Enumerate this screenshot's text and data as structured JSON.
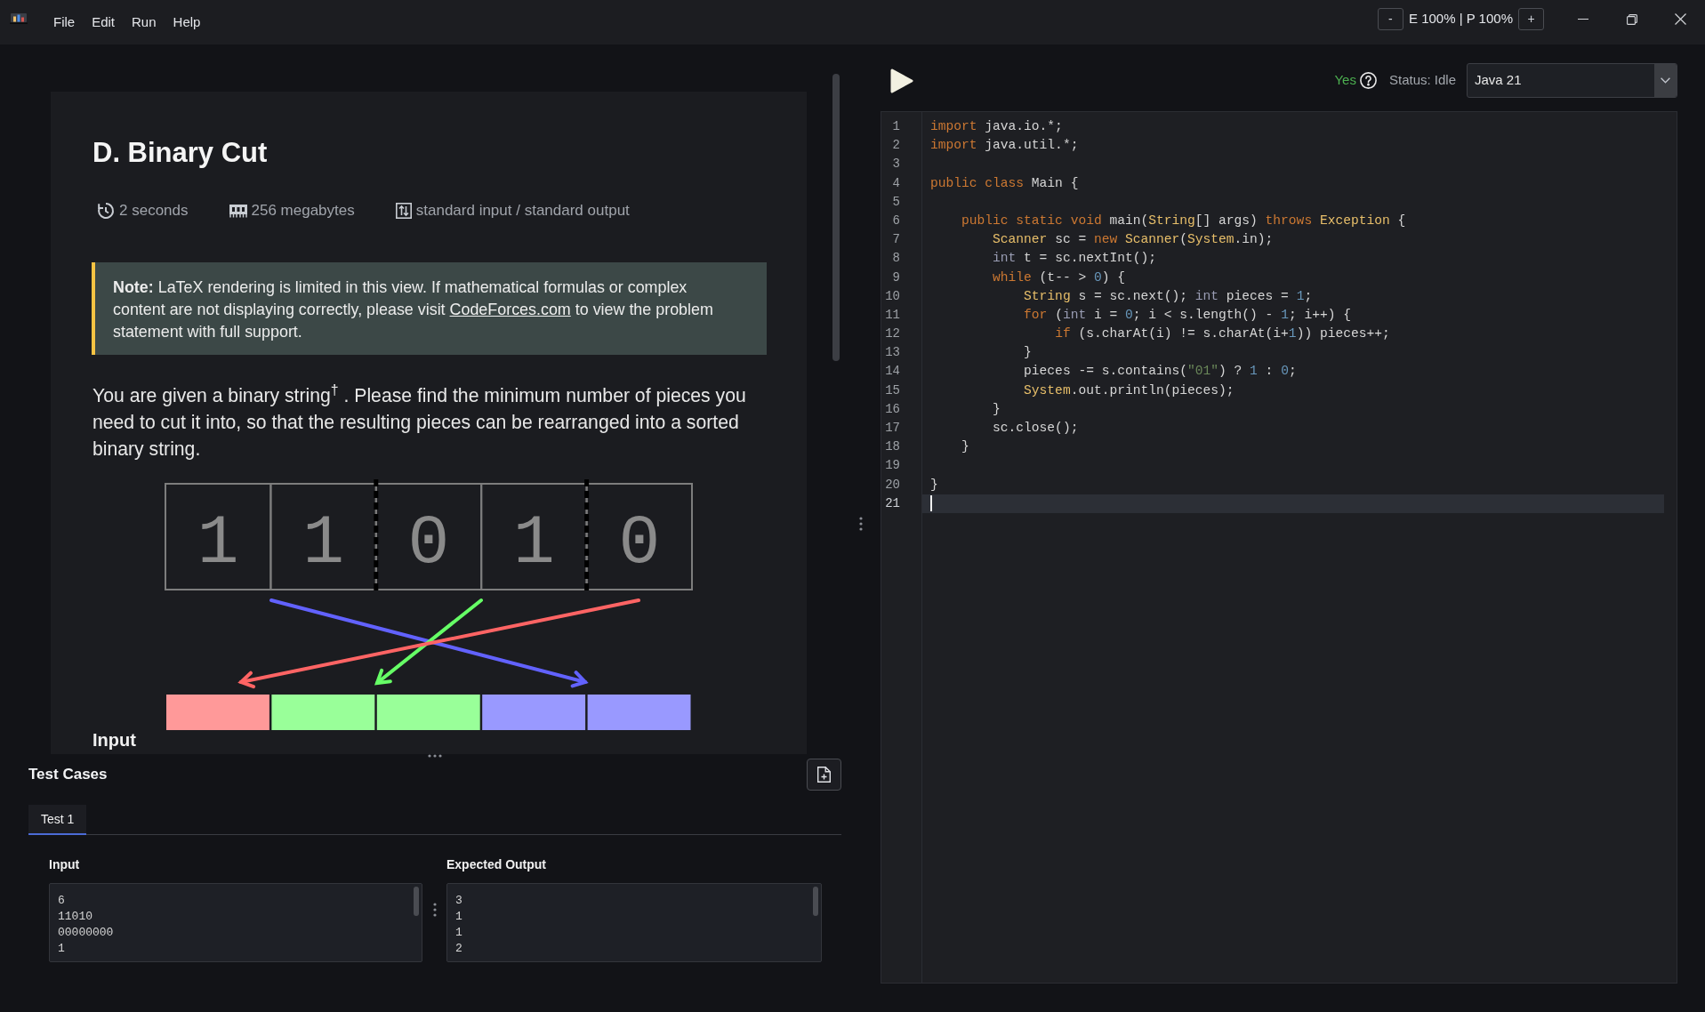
{
  "window": {
    "menu": [
      {
        "label": "File"
      },
      {
        "label": "Edit"
      },
      {
        "label": "Run"
      },
      {
        "label": "Help"
      }
    ],
    "zoom": {
      "decrease": "-",
      "reading": "E 100% | P 100%",
      "increase": "+"
    }
  },
  "problem": {
    "title": "D. Binary Cut",
    "limits": [
      {
        "kind": "time",
        "text": "2 seconds"
      },
      {
        "kind": "memory",
        "text": "256 megabytes"
      },
      {
        "kind": "io",
        "text": "standard input / standard output"
      }
    ],
    "note": {
      "text": "**Note:** LaTeX rendering is limited in this view. If mathematical formulas or complex content are not displaying correctly, please visit ",
      "link": "CodeForces.com",
      "text_after": " to view the problem statement with full support."
    },
    "statement": "You are given a binary string$^{†}$ . Please find the minimum number of pieces you need to cut it into, so that the resulting pieces can be rearranged into a sorted binary string.",
    "figure": {
      "cells": [
        {
          "digit": "1",
          "cut_after": false
        },
        {
          "digit": "1",
          "cut_after": true
        },
        {
          "digit": "0",
          "cut_after": false
        },
        {
          "digit": "1",
          "cut_after": true
        },
        {
          "digit": "0",
          "cut_after": false
        }
      ],
      "arrows": [
        {
          "color": "#6262ff"
        },
        {
          "color": "#66ff66"
        },
        {
          "color": "#ff6464"
        }
      ],
      "tiles": [
        {
          "color": "#ff9999"
        },
        {
          "color": "#99ff99"
        },
        {
          "color": "#99ff99"
        },
        {
          "color": "#9999ff"
        },
        {
          "color": "#9999ff"
        }
      ]
    },
    "next_heading": "Input"
  },
  "toolbar": {
    "indicator": "Yes",
    "status": "Status: Idle",
    "language": "Java 21"
  },
  "editor": {
    "lines": [
      {
        "number": "1",
        "current": false,
        "tokens": [
          {
            "kind": "keyword",
            "text": "import"
          },
          {
            "kind": "plain",
            "text": " java.io.*;"
          }
        ]
      },
      {
        "number": "2",
        "current": false,
        "tokens": [
          {
            "kind": "keyword",
            "text": "import"
          },
          {
            "kind": "plain",
            "text": " java.util.*;"
          }
        ]
      },
      {
        "number": "3",
        "current": false
      },
      {
        "number": "4",
        "current": false,
        "tokens": [
          {
            "kind": "keyword",
            "text": "public class"
          },
          {
            "kind": "plain",
            "text": " Main {"
          }
        ]
      },
      {
        "number": "5",
        "current": false
      },
      {
        "number": "6",
        "current": false,
        "tokens": [
          {
            "kind": "keyword",
            "text": "    public static void"
          },
          {
            "kind": "plain",
            "text": " main("
          },
          {
            "kind": "type",
            "text": "String"
          },
          {
            "kind": "plain",
            "text": "[] args) "
          },
          {
            "kind": "keyword",
            "text": "throws"
          },
          {
            "kind": "type",
            "text": " Exception"
          },
          {
            "kind": "plain",
            "text": " {"
          }
        ]
      },
      {
        "number": "7",
        "current": false,
        "tokens": [
          {
            "kind": "type",
            "text": "        Scanner"
          },
          {
            "kind": "plain",
            "text": " sc = "
          },
          {
            "kind": "keyword",
            "text": "new"
          },
          {
            "kind": "type",
            "text": " Scanner"
          },
          {
            "kind": "plain",
            "text": "("
          },
          {
            "kind": "type",
            "text": "System"
          },
          {
            "kind": "plain",
            "text": ".in);"
          }
        ]
      },
      {
        "number": "8",
        "current": false,
        "tokens": [
          {
            "kind": "primitive",
            "text": "        int"
          },
          {
            "kind": "plain",
            "text": " t = sc.nextInt();"
          }
        ]
      },
      {
        "number": "9",
        "current": false,
        "tokens": [
          {
            "kind": "keyword",
            "text": "        while"
          },
          {
            "kind": "plain",
            "text": " (t-- > "
          },
          {
            "kind": "number",
            "text": "0"
          },
          {
            "kind": "plain",
            "text": ") {"
          }
        ]
      },
      {
        "number": "10",
        "current": false,
        "tokens": [
          {
            "kind": "type",
            "text": "            String"
          },
          {
            "kind": "plain",
            "text": " s = sc.next(); "
          },
          {
            "kind": "primitive",
            "text": "int"
          },
          {
            "kind": "plain",
            "text": " pieces = "
          },
          {
            "kind": "number",
            "text": "1"
          },
          {
            "kind": "plain",
            "text": ";"
          }
        ]
      },
      {
        "number": "11",
        "current": false,
        "tokens": [
          {
            "kind": "keyword",
            "text": "            for"
          },
          {
            "kind": "plain",
            "text": " ("
          },
          {
            "kind": "primitive",
            "text": "int"
          },
          {
            "kind": "plain",
            "text": " i = "
          },
          {
            "kind": "number",
            "text": "0"
          },
          {
            "kind": "plain",
            "text": "; i < s.length() - "
          },
          {
            "kind": "number",
            "text": "1"
          },
          {
            "kind": "plain",
            "text": "; i++) {"
          }
        ]
      },
      {
        "number": "12",
        "current": false,
        "tokens": [
          {
            "kind": "keyword",
            "text": "                if"
          },
          {
            "kind": "plain",
            "text": " (s.charAt(i) != s.charAt(i+"
          },
          {
            "kind": "number",
            "text": "1"
          },
          {
            "kind": "plain",
            "text": ")) pieces++;"
          }
        ]
      },
      {
        "number": "13",
        "current": false,
        "tokens": [
          {
            "kind": "plain",
            "text": "            }"
          }
        ]
      },
      {
        "number": "14",
        "current": false,
        "tokens": [
          {
            "kind": "plain",
            "text": "            pieces -= s.contains("
          },
          {
            "kind": "string",
            "text": "\"01\""
          },
          {
            "kind": "plain",
            "text": ") ? "
          },
          {
            "kind": "number",
            "text": "1"
          },
          {
            "kind": "plain",
            "text": " : "
          },
          {
            "kind": "number",
            "text": "0"
          },
          {
            "kind": "plain",
            "text": ";"
          }
        ]
      },
      {
        "number": "15",
        "current": false,
        "tokens": [
          {
            "kind": "type",
            "text": "            System"
          },
          {
            "kind": "plain",
            "text": ".out.println(pieces);"
          }
        ]
      },
      {
        "number": "16",
        "current": false,
        "tokens": [
          {
            "kind": "plain",
            "text": "        }"
          }
        ]
      },
      {
        "number": "17",
        "current": false,
        "tokens": [
          {
            "kind": "plain",
            "text": "        sc.close();"
          }
        ]
      },
      {
        "number": "18",
        "current": false,
        "tokens": [
          {
            "kind": "plain",
            "text": "    }"
          }
        ]
      },
      {
        "number": "19",
        "current": false
      },
      {
        "number": "20",
        "current": false,
        "tokens": [
          {
            "kind": "plain",
            "text": "}"
          }
        ]
      },
      {
        "number": "21",
        "current": true
      }
    ]
  },
  "test_cases": {
    "title": "Test Cases",
    "tabs": [
      {
        "label": "Test 1",
        "selected": true
      }
    ],
    "input": {
      "label": "Input",
      "value": "6\n11010\n00000000\n1"
    },
    "expected": {
      "label": "Expected Output",
      "value": "3\n1\n1\n2"
    }
  }
}
